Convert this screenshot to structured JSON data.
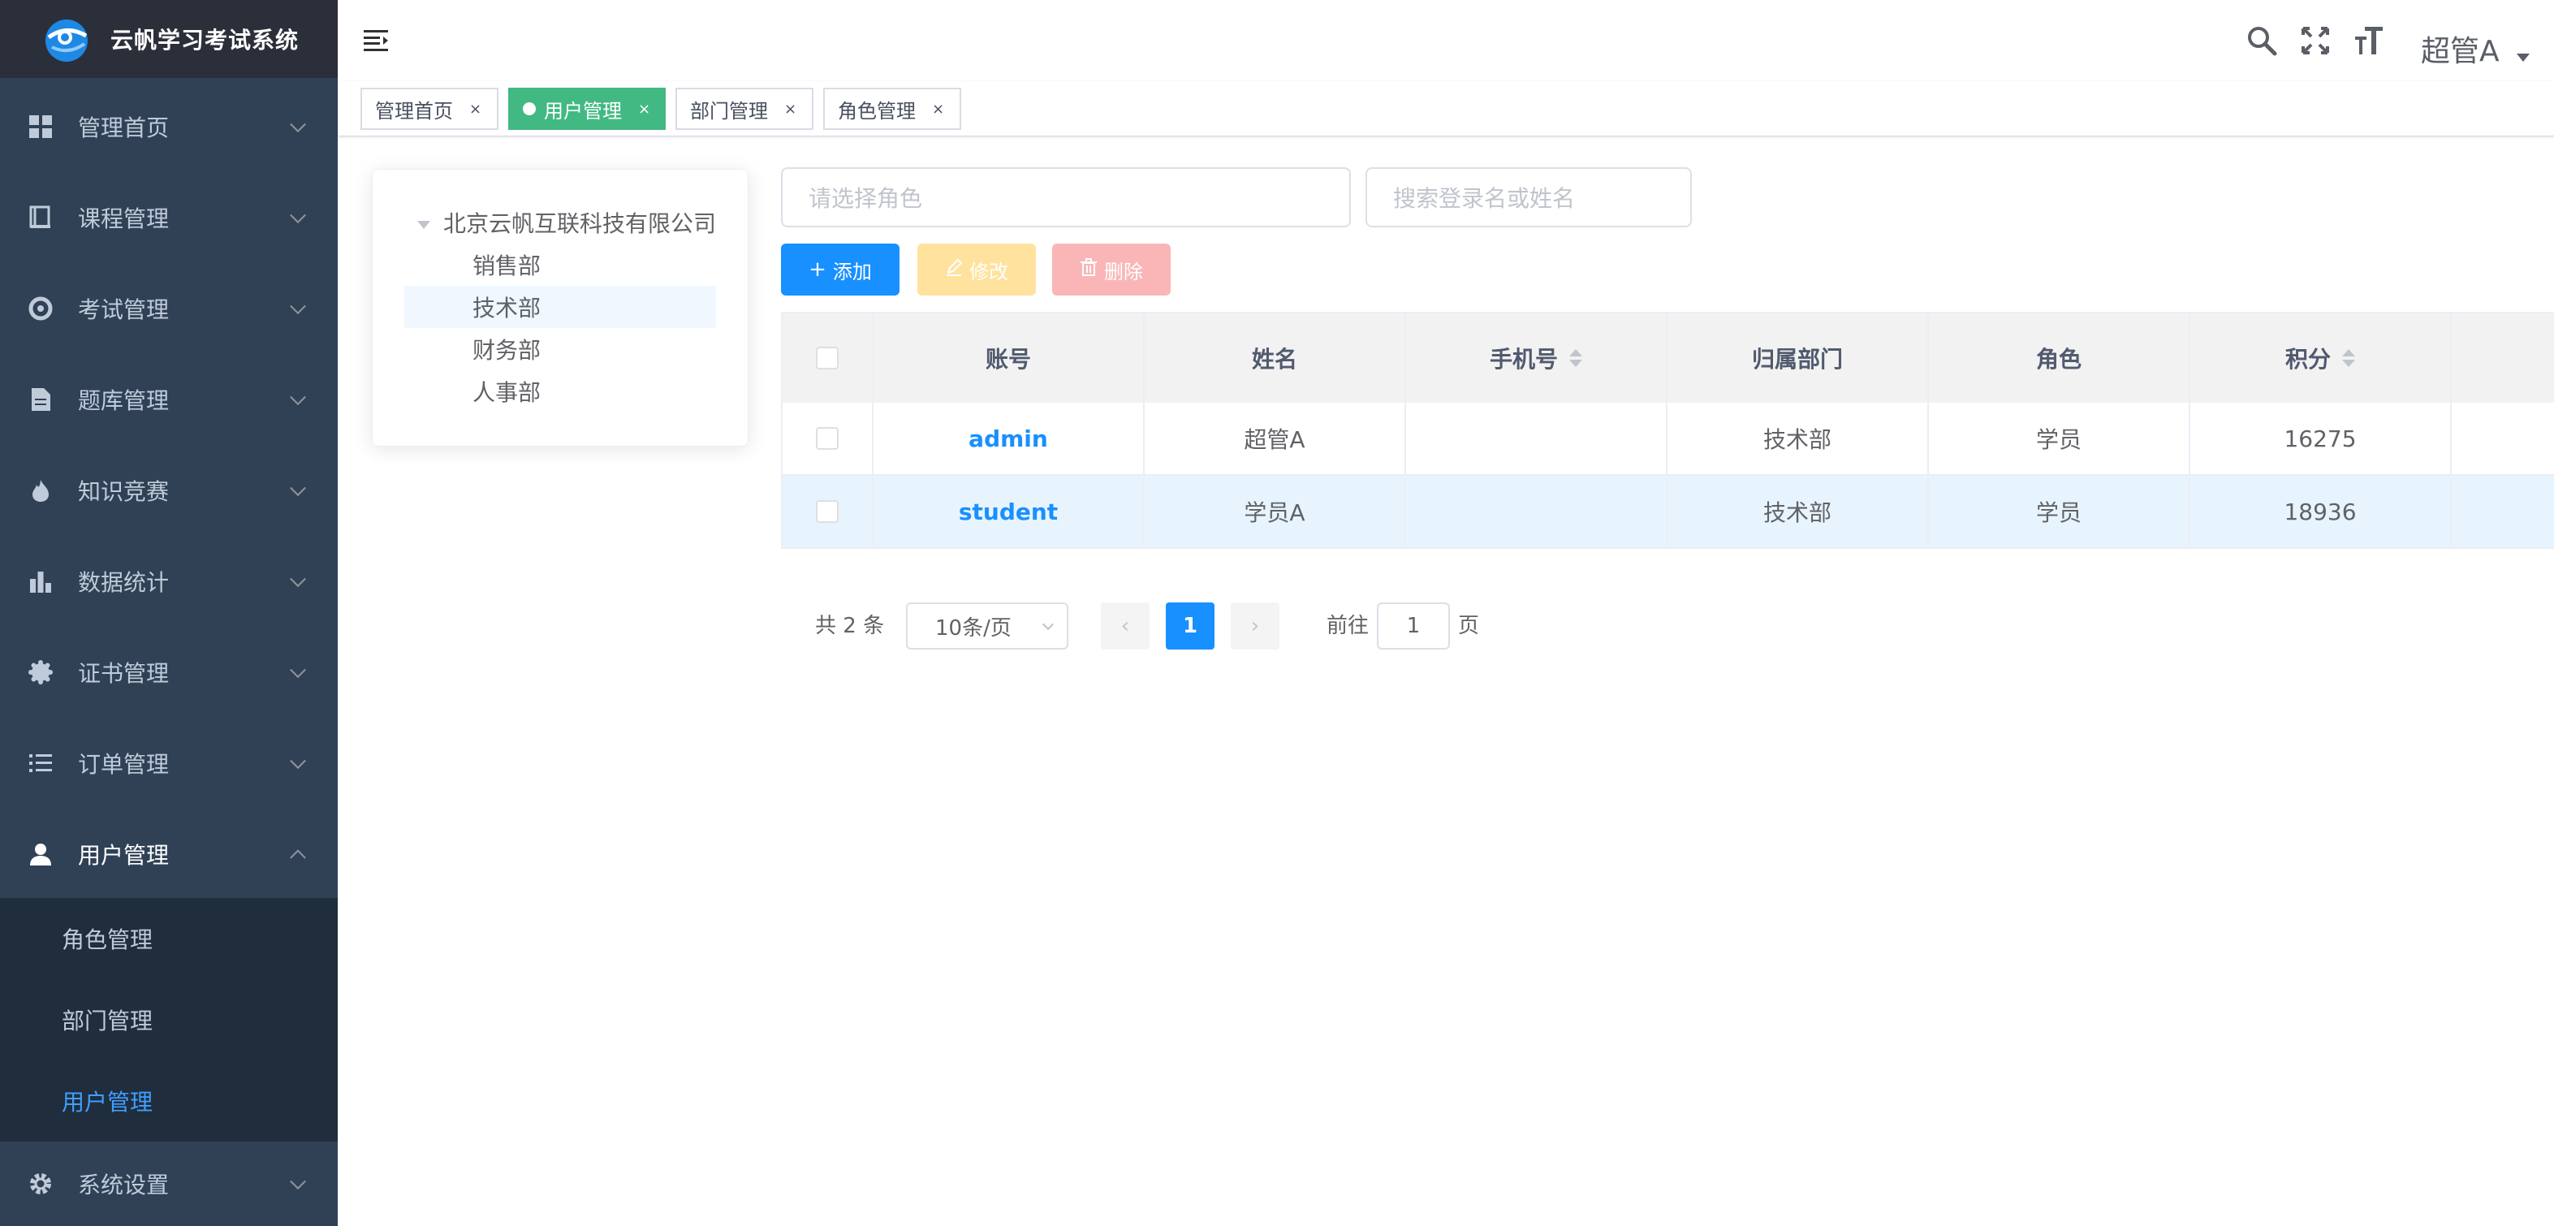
{
  "app": {
    "title": "云帆学习考试系统"
  },
  "sidebar": {
    "items": [
      {
        "label": "管理首页",
        "icon": "dashboard-icon"
      },
      {
        "label": "课程管理",
        "icon": "book-icon"
      },
      {
        "label": "考试管理",
        "icon": "exam-icon"
      },
      {
        "label": "题库管理",
        "icon": "document-icon"
      },
      {
        "label": "知识竞赛",
        "icon": "flame-icon"
      },
      {
        "label": "数据统计",
        "icon": "bar-chart-icon"
      },
      {
        "label": "证书管理",
        "icon": "certificate-icon"
      },
      {
        "label": "订单管理",
        "icon": "list-icon"
      },
      {
        "label": "用户管理",
        "icon": "user-icon"
      },
      {
        "label": "系统设置",
        "icon": "gear-icon"
      }
    ],
    "submenu": [
      {
        "label": "角色管理"
      },
      {
        "label": "部门管理"
      },
      {
        "label": "用户管理"
      }
    ]
  },
  "header": {
    "user_name": "超管A"
  },
  "tags": [
    {
      "label": "管理首页",
      "close": "×"
    },
    {
      "label": "用户管理",
      "close": "×"
    },
    {
      "label": "部门管理",
      "close": "×"
    },
    {
      "label": "角色管理",
      "close": "×"
    }
  ],
  "tree": {
    "root": "北京云帆互联科技有限公司",
    "children": [
      "销售部",
      "技术部",
      "财务部",
      "人事部"
    ],
    "selected": "技术部"
  },
  "filters": {
    "role_placeholder": "请选择角色",
    "search_placeholder": "搜索登录名或姓名"
  },
  "toolbar": {
    "add_label": "添加",
    "edit_label": "修改",
    "delete_label": "删除"
  },
  "table": {
    "columns": [
      "账号",
      "姓名",
      "手机号",
      "归属部门",
      "角色",
      "积分"
    ],
    "rows": [
      {
        "account": "admin",
        "name": "超管A",
        "phone": "",
        "dept": "技术部",
        "role": "学员",
        "points": "16275"
      },
      {
        "account": "student",
        "name": "学员A",
        "phone": "",
        "dept": "技术部",
        "role": "学员",
        "points": "18936"
      }
    ]
  },
  "pagination": {
    "total": "共 2 条",
    "page_size": "10条/页",
    "current": "1",
    "goto_label": "前往",
    "goto_value": "1",
    "page_suffix": "页"
  },
  "colors": {
    "sidebar_bg": "#304156",
    "sidebar_active": "#409eff",
    "primary": "#1890ff",
    "tag_active": "#42b983"
  }
}
